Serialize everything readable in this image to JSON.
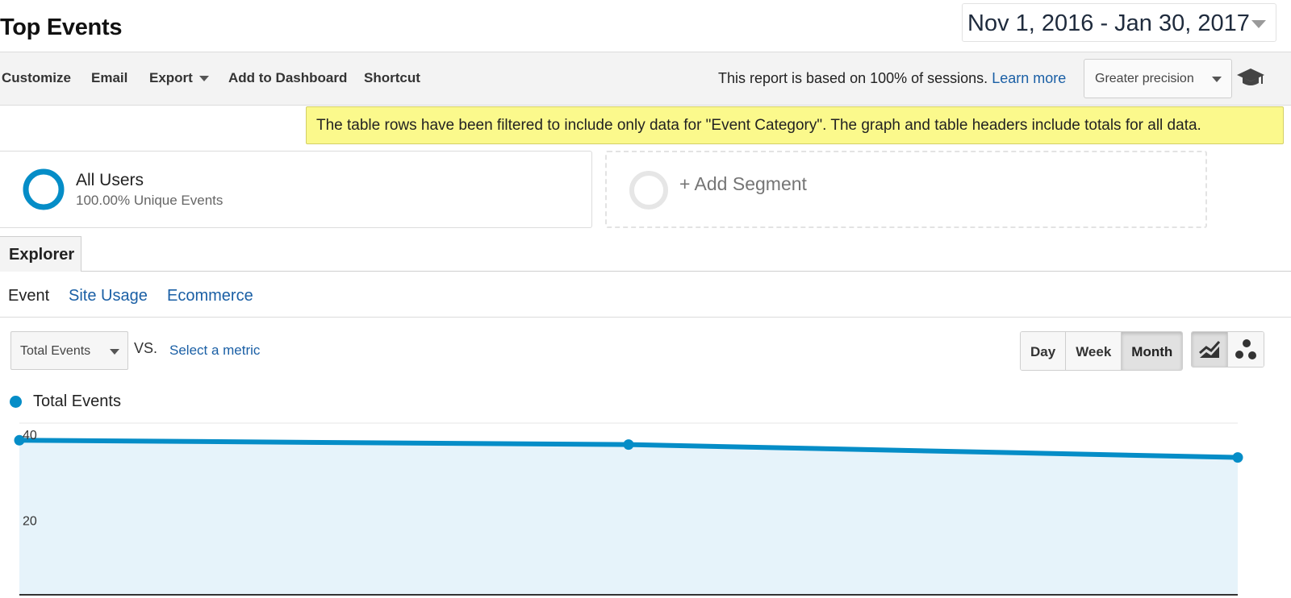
{
  "page": {
    "title": "Top Events"
  },
  "date_range": {
    "label": "Nov 1, 2016 - Jan 30, 2017"
  },
  "toolbar": {
    "customize": "Customize",
    "email": "Email",
    "export": "Export",
    "add_to_dashboard": "Add to Dashboard",
    "shortcut": "Shortcut",
    "report_note": "This report is based on 100% of sessions.",
    "learn_more": "Learn more",
    "precision": "Greater precision",
    "help_icon": "graduation-cap-icon"
  },
  "filter_notice": "The table rows have been filtered to include only data for \"Event Category\". The graph and table headers include totals for all data.",
  "segments": {
    "all_users": {
      "name": "All Users",
      "detail": "100.00% Unique Events",
      "color": "#058dc7"
    },
    "add_segment": "+ Add Segment"
  },
  "tabs": {
    "explorer": "Explorer"
  },
  "subtabs": {
    "event": "Event",
    "site_usage": "Site Usage",
    "ecommerce": "Ecommerce"
  },
  "metric_controls": {
    "primary_metric": "Total Events",
    "vs": "VS.",
    "select_metric": "Select a metric"
  },
  "period_buttons": {
    "day": "Day",
    "week": "Week",
    "month": "Month",
    "selected": "Month"
  },
  "chart_type_buttons": {
    "selected": "line-chart",
    "icons": [
      "line-chart-icon",
      "motion-chart-icon"
    ]
  },
  "chart_data": {
    "type": "area",
    "series": [
      {
        "name": "Total Events",
        "values": [
          36,
          35,
          32
        ],
        "color": "#058dc7"
      }
    ],
    "yticks": [
      20,
      40
    ],
    "ylim": [
      0,
      40
    ],
    "grid": true
  }
}
